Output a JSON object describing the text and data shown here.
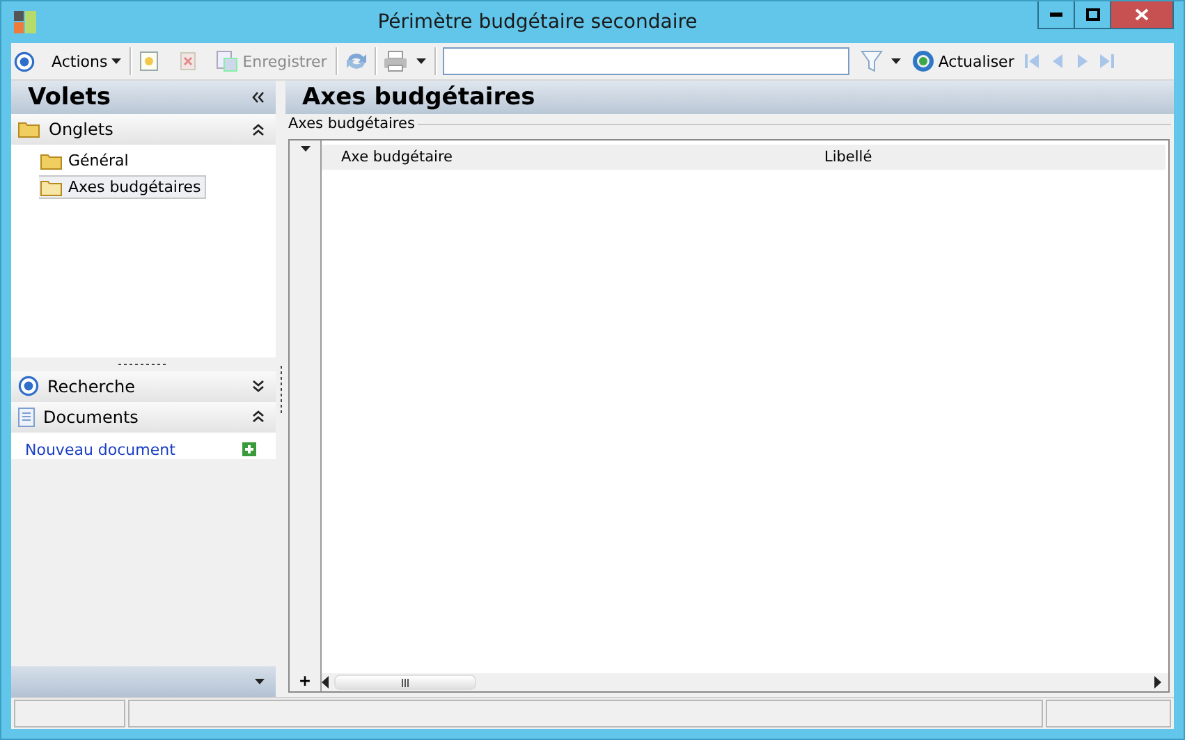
{
  "window": {
    "title": "Périmètre budgétaire secondaire"
  },
  "toolbar": {
    "actions": "Actions",
    "save": {
      "label": "Enregistrer",
      "disabled": true
    },
    "refresh": "Actualiser"
  },
  "left_panel": {
    "title": "Volets",
    "sections": [
      {
        "kind": "tree",
        "title": "Onglets",
        "expanded": true,
        "items": [
          {
            "label": "Général",
            "selected": false
          },
          {
            "label": "Axes budgétaires",
            "selected": true
          }
        ]
      },
      {
        "kind": "search",
        "title": "Recherche",
        "expanded": false
      },
      {
        "kind": "links",
        "title": "Documents",
        "expanded": true,
        "links": [
          "Nouveau document"
        ]
      }
    ]
  },
  "content": {
    "title": "Axes budgétaires",
    "group": "Axes budgétaires",
    "grid": {
      "columns": [
        "Axe budgétaire",
        "Libellé"
      ],
      "add_row": "+"
    }
  }
}
